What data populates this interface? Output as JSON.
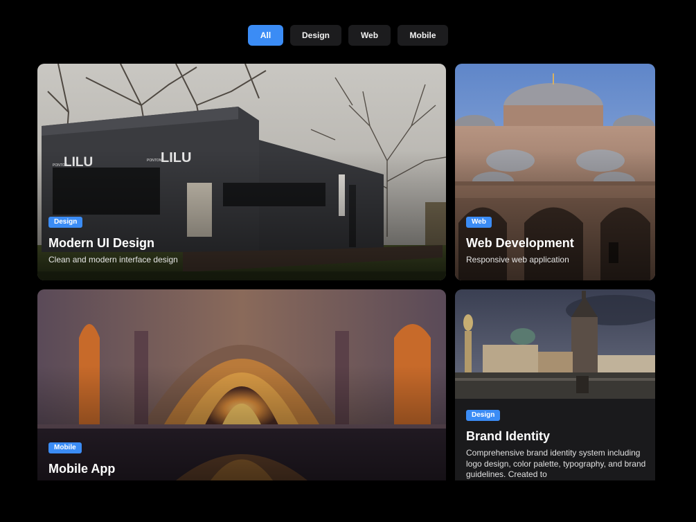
{
  "filters": [
    {
      "label": "All",
      "active": true
    },
    {
      "label": "Design",
      "active": false
    },
    {
      "label": "Web",
      "active": false
    },
    {
      "label": "Mobile",
      "active": false
    }
  ],
  "projects": [
    {
      "tag": "Design",
      "title": "Modern UI Design",
      "description": "Clean and modern interface design",
      "image": "pavilion-photo"
    },
    {
      "tag": "Web",
      "title": "Web Development",
      "description": "Responsive web application",
      "image": "mosque-photo"
    },
    {
      "tag": "Mobile",
      "title": "Mobile App",
      "description": "",
      "image": "arched-hall-photo"
    },
    {
      "tag": "Design",
      "title": "Brand Identity",
      "description": "Comprehensive brand identity system including logo design, color palette, typography, and brand guidelines. Created to",
      "image": "bridge-tower-photo"
    }
  ],
  "photo_signs": {
    "big": "LILU",
    "small": "PONTON"
  },
  "colors": {
    "accent": "#3b8cf5",
    "background": "#000000",
    "chip": "#1c1c1e",
    "card": "#1a1a1c"
  }
}
